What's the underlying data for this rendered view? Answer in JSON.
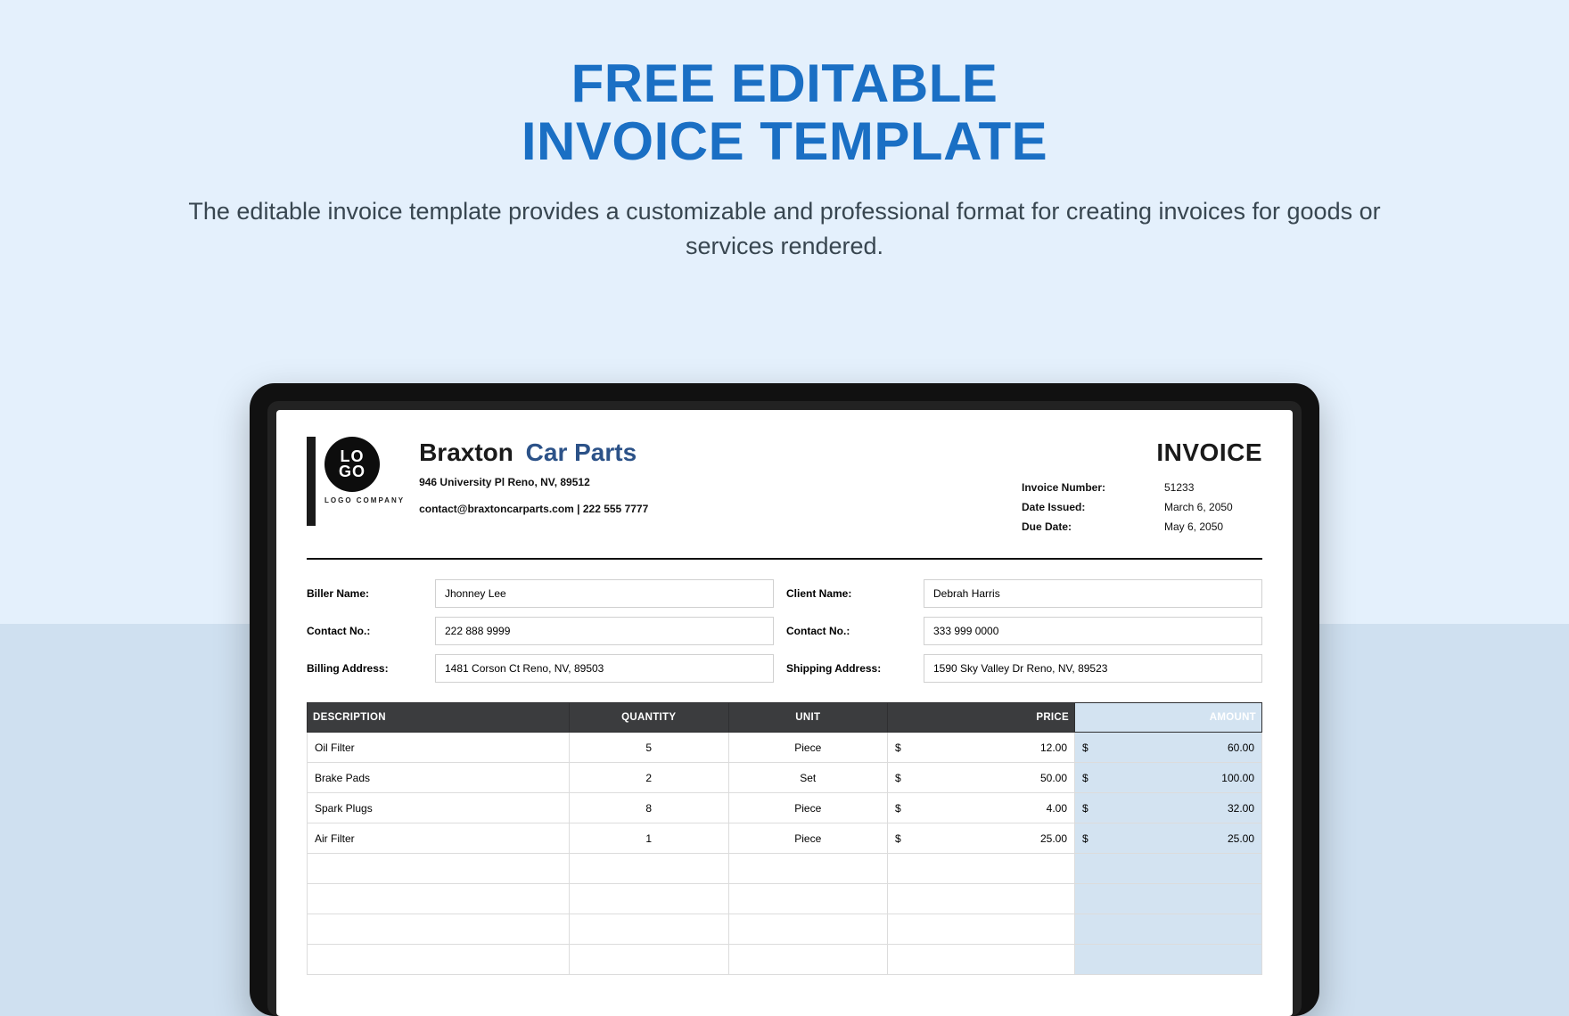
{
  "headline": {
    "line1": "FREE EDITABLE",
    "line2": "INVOICE TEMPLATE"
  },
  "subtext": "The editable invoice template provides a customizable and professional format for creating invoices for goods or services rendered.",
  "logo": {
    "top": "LO",
    "bottom": "GO",
    "sub": "LOGO COMPANY"
  },
  "company": {
    "name1": "Braxton",
    "name2": "Car Parts",
    "address": "946 University Pl Reno, NV, 89512",
    "contact": "contact@braxtoncarparts.com | 222 555 7777"
  },
  "invoice_title": "INVOICE",
  "meta": {
    "number_label": "Invoice Number:",
    "number_value": "51233",
    "issued_label": "Date Issued:",
    "issued_value": "March 6, 2050",
    "due_label": "Due Date:",
    "due_value": "May 6, 2050"
  },
  "party": {
    "biller_name_label": "Biller Name:",
    "biller_name": "Jhonney Lee",
    "biller_contact_label": "Contact No.:",
    "biller_contact": "222 888 9999",
    "billing_addr_label": "Billing Address:",
    "billing_addr": "1481 Corson Ct Reno, NV, 89503",
    "client_name_label": "Client Name:",
    "client_name": "Debrah Harris",
    "client_contact_label": "Contact No.:",
    "client_contact": "333 999 0000",
    "shipping_addr_label": "Shipping Address:",
    "shipping_addr": "1590 Sky Valley Dr Reno, NV, 89523"
  },
  "columns": {
    "desc": "DESCRIPTION",
    "qty": "QUANTITY",
    "unit": "UNIT",
    "price": "PRICE",
    "amount": "AMOUNT"
  },
  "currency": "$",
  "items": [
    {
      "desc": "Oil Filter",
      "qty": "5",
      "unit": "Piece",
      "price": "12.00",
      "amount": "60.00"
    },
    {
      "desc": "Brake Pads",
      "qty": "2",
      "unit": "Set",
      "price": "50.00",
      "amount": "100.00"
    },
    {
      "desc": "Spark Plugs",
      "qty": "8",
      "unit": "Piece",
      "price": "4.00",
      "amount": "32.00"
    },
    {
      "desc": "Air Filter",
      "qty": "1",
      "unit": "Piece",
      "price": "25.00",
      "amount": "25.00"
    }
  ]
}
